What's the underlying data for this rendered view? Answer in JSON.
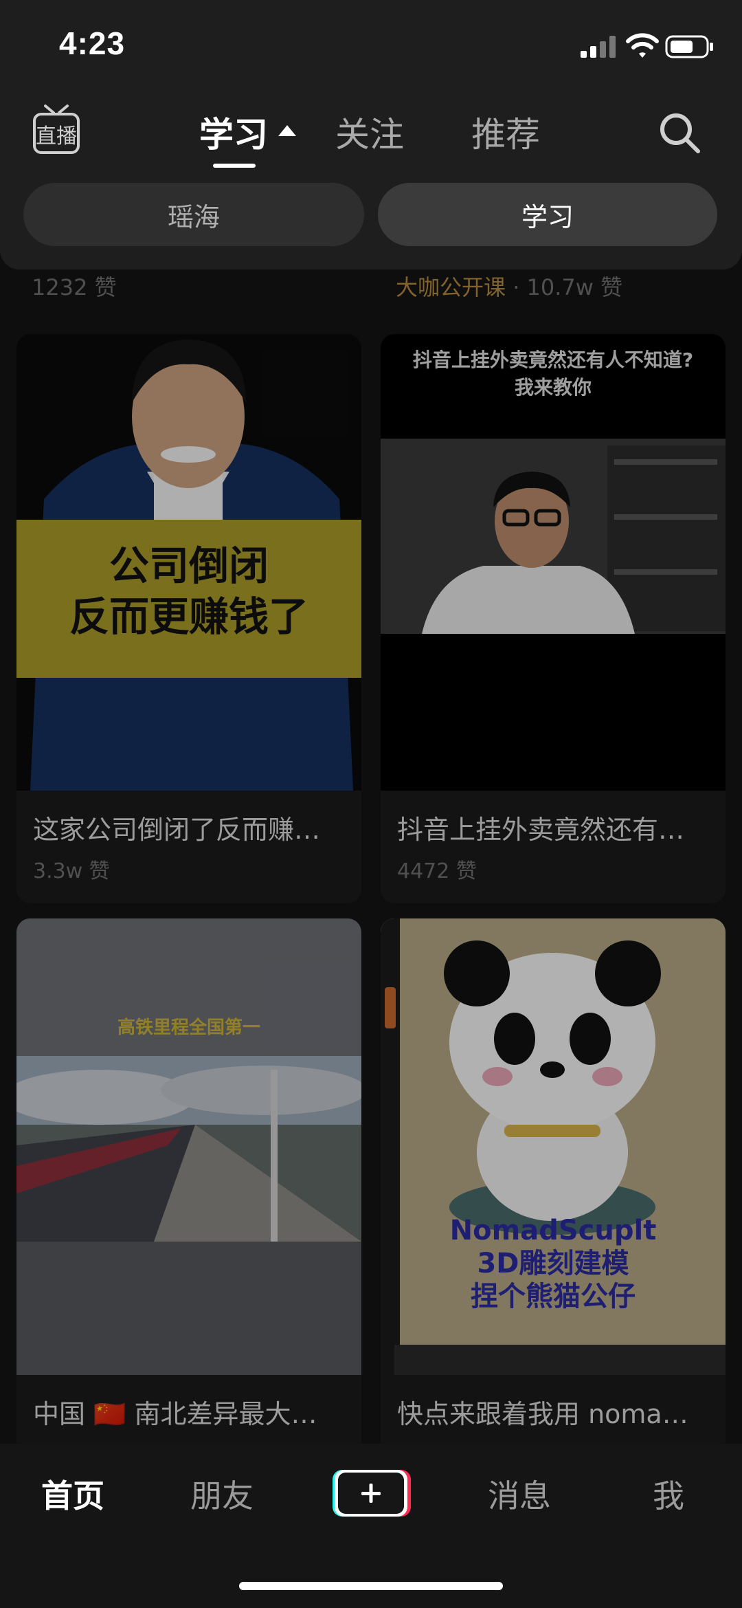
{
  "status": {
    "time": "4:23"
  },
  "header": {
    "tabs": [
      {
        "label": "学习",
        "active": true
      },
      {
        "label": "关注"
      },
      {
        "label": "推荐"
      }
    ],
    "sub_tabs": [
      "瑶海",
      "学习"
    ]
  },
  "prev_row": {
    "left_likes": "1232 赞",
    "right_tag": "大咖公开课",
    "right_sep": "·",
    "right_likes": "10.7w 赞"
  },
  "cards": [
    {
      "overlay": "公司倒闭\n反而更赚钱了",
      "title": "这家公司倒闭了反而赚…",
      "likes": "3.3w 赞"
    },
    {
      "overlay": "抖音上挂外卖竟然还有人不知道?\n我来教你",
      "title": "抖音上挂外卖竟然还有…",
      "likes": "4472 赞"
    },
    {
      "overlay": "高铁里程全国第一",
      "title": "中国 🇨🇳 南北差异最大…"
    },
    {
      "overlay": "NomadScuplt\n3D雕刻建模\n捏个熊猫公仔",
      "title": "快点来跟着我用 noma…"
    }
  ],
  "bottom_nav": [
    "首页",
    "朋友",
    "消息",
    "我"
  ],
  "icons": [
    "live-icon",
    "search-icon",
    "plus-icon",
    "signal-icon",
    "wifi-icon",
    "battery-icon"
  ],
  "colors": {
    "background": "#141414",
    "accent_tag": "#b58a3c",
    "banner_yellow": "#a89a27"
  }
}
